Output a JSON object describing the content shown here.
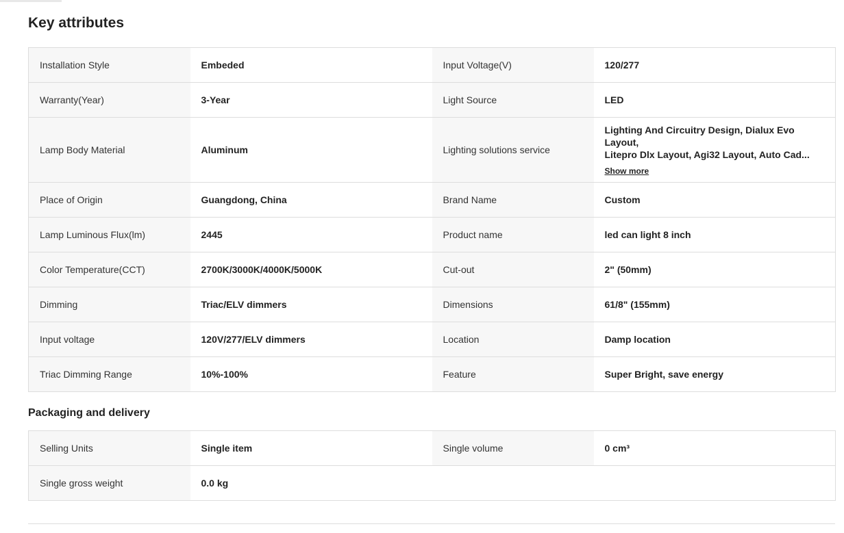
{
  "key_attributes": {
    "title": "Key attributes",
    "rows": [
      {
        "k1": "Installation Style",
        "v1": "Embeded",
        "k2": "Input Voltage(V)",
        "v2": "120/277"
      },
      {
        "k1": "Warranty(Year)",
        "v1": "3-Year",
        "k2": "Light Source",
        "v2": "LED"
      },
      {
        "k1": "Lamp Body Material",
        "v1": "Aluminum",
        "k2": "Lighting solutions service",
        "v2_line1": "Lighting And Circuitry Design, Dialux Evo Layout,",
        "v2_line2": "Litepro Dlx Layout, Agi32 Layout, Auto Cad...",
        "show_more": "Show more"
      },
      {
        "k1": "Place of Origin",
        "v1": "Guangdong, China",
        "k2": "Brand Name",
        "v2": "Custom"
      },
      {
        "k1": "Lamp Luminous Flux(lm)",
        "v1": "2445",
        "k2": "Product name",
        "v2": "led can light 8 inch"
      },
      {
        "k1": "Color Temperature(CCT)",
        "v1": "2700K/3000K/4000K/5000K",
        "k2": "Cut-out",
        "v2": "2\" (50mm)"
      },
      {
        "k1": "Dimming",
        "v1": "Triac/ELV dimmers",
        "k2": "Dimensions",
        "v2": "61/8\" (155mm)"
      },
      {
        "k1": "Input voltage",
        "v1": "120V/277/ELV dimmers",
        "k2": "Location",
        "v2": "Damp location"
      },
      {
        "k1": "Triac Dimming Range",
        "v1": "10%-100%",
        "k2": "Feature",
        "v2": "Super Bright, save energy"
      }
    ]
  },
  "packaging": {
    "title": "Packaging and delivery",
    "rows": [
      {
        "k1": "Selling Units",
        "v1": "Single item",
        "k2": "Single volume",
        "v2": "0 cm³"
      },
      {
        "k1": "Single gross weight",
        "v1": "0.0 kg",
        "k2": "",
        "v2": ""
      }
    ]
  }
}
